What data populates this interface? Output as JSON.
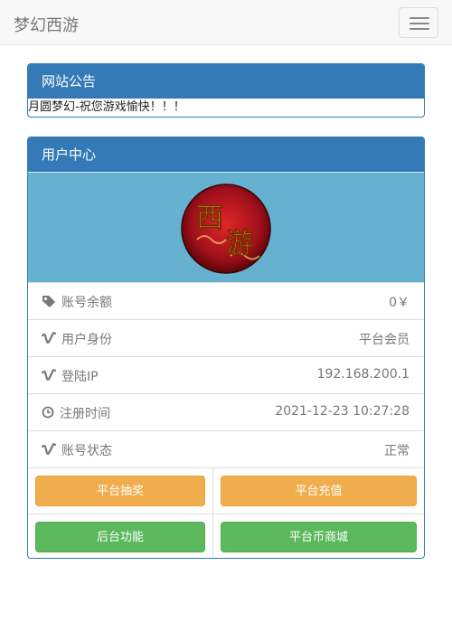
{
  "navbar": {
    "brand": "梦幻西游"
  },
  "notice": {
    "title": "网站公告",
    "text": "月圆梦幻-祝您游戏愉快！！！"
  },
  "user_center": {
    "title": "用户中心",
    "avatar_text": "西游",
    "rows": [
      {
        "icon": "tag-icon",
        "label": "账号余额",
        "value": "0￥"
      },
      {
        "icon": "vimeo-icon",
        "label": "用户身份",
        "value": "平台会员"
      },
      {
        "icon": "vimeo-icon",
        "label": "登陆IP",
        "value": "192.168.200.1"
      },
      {
        "icon": "clock-icon",
        "label": "注册时间",
        "value": "2021-12-23 10:27:28"
      },
      {
        "icon": "vimeo-icon",
        "label": "账号状态",
        "value": "正常"
      }
    ],
    "buttons": {
      "lottery": "平台抽奖",
      "recharge": "平台充值",
      "backend": "后台功能",
      "shop": "平台币商城"
    }
  },
  "colors": {
    "primary": "#337ab7",
    "warning": "#f0ad4e",
    "success": "#5cb85c",
    "banner": "#66b0d0"
  }
}
